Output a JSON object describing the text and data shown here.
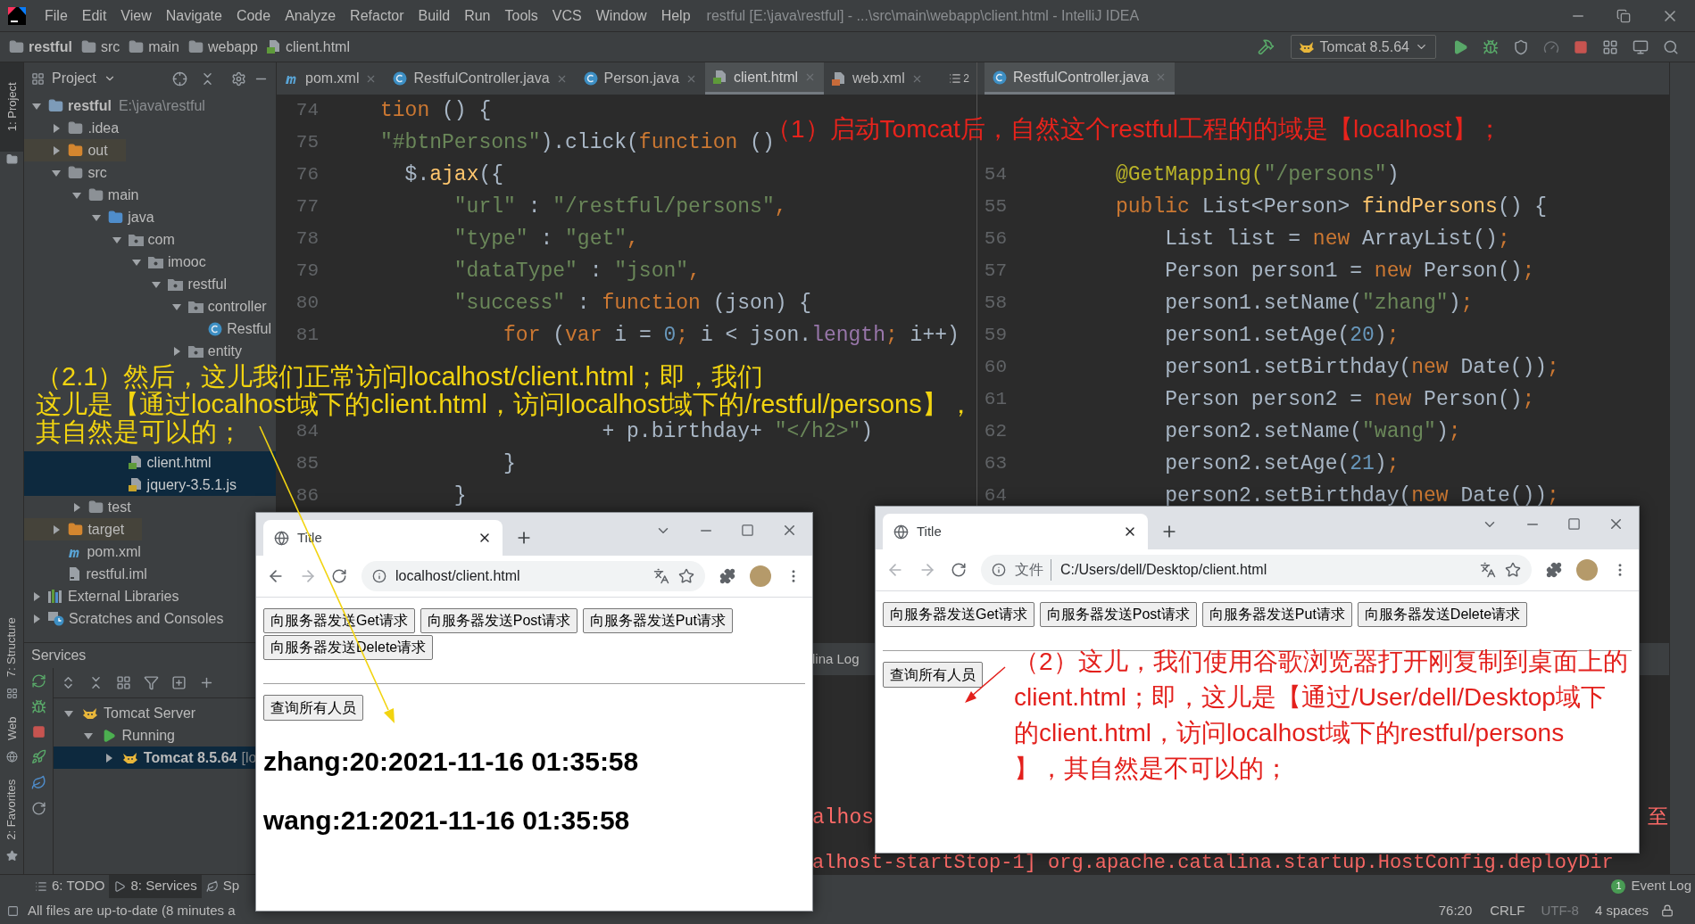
{
  "window": {
    "title": "restful [E:\\java\\restful] - ...\\src\\main\\webapp\\client.html - IntelliJ IDEA"
  },
  "menu": [
    "File",
    "Edit",
    "View",
    "Navigate",
    "Code",
    "Analyze",
    "Refactor",
    "Build",
    "Run",
    "Tools",
    "VCS",
    "Window",
    "Help"
  ],
  "breadcrumbs": [
    "restful",
    "src",
    "main",
    "webapp",
    "client.html"
  ],
  "run_config": "Tomcat 8.5.64",
  "left_stripe": [
    "1: Project",
    "7: Structure",
    "Web",
    "2: Favorites"
  ],
  "project_panel": {
    "title": "Project",
    "tree": [
      {
        "label": "restful",
        "hint": "E:\\java\\restful",
        "kind": "module",
        "expanded": true,
        "selected": false,
        "children": [
          {
            "label": ".idea",
            "kind": "folder",
            "expanded": false,
            "selected": false
          },
          {
            "label": "out",
            "kind": "excluded",
            "expanded": false,
            "selected": false
          },
          {
            "label": "src",
            "kind": "folder",
            "expanded": true,
            "selected": false,
            "children": [
              {
                "label": "main",
                "kind": "folder",
                "expanded": true,
                "selected": false,
                "children": [
                  {
                    "label": "java",
                    "kind": "source",
                    "expanded": true,
                    "selected": false,
                    "children": [
                      {
                        "label": "com",
                        "kind": "package",
                        "expanded": true,
                        "selected": false,
                        "children": [
                          {
                            "label": "imooc",
                            "kind": "package",
                            "expanded": true,
                            "selected": false,
                            "children": [
                              {
                                "label": "restful",
                                "kind": "package",
                                "expanded": true,
                                "selected": false,
                                "children": [
                                  {
                                    "label": "controller",
                                    "kind": "package",
                                    "expanded": true,
                                    "selected": false,
                                    "children": [
                                      {
                                        "label": "Restful",
                                        "kind": "class",
                                        "selected": false
                                      }
                                    ]
                                  },
                                  {
                                    "label": "entity",
                                    "kind": "package",
                                    "expanded": false,
                                    "selected": false
                                  }
                                ]
                              }
                            ]
                          }
                        ]
                      }
                    ]
                  },
                  {
                    "kind": "covered",
                    "children": [
                      {
                        "kind": "covered"
                      }
                    ]
                  },
                  {
                    "kind": "covered",
                    "children": [
                      {
                        "kind": "covered"
                      },
                      {
                        "label": "client.html",
                        "kind": "html",
                        "selected": true
                      },
                      {
                        "label": "jquery-3.5.1.js",
                        "kind": "js",
                        "selected": true
                      }
                    ]
                  }
                ]
              },
              {
                "label": "test",
                "kind": "folder",
                "expanded": false,
                "selected": false
              }
            ]
          },
          {
            "label": "target",
            "kind": "excluded",
            "expanded": false,
            "selected": false
          },
          {
            "label": "pom.xml",
            "kind": "maven",
            "selected": false
          },
          {
            "label": "restful.iml",
            "kind": "iml",
            "selected": false
          }
        ]
      },
      {
        "label": "External Libraries",
        "kind": "libraries",
        "expanded": false,
        "selected": false
      },
      {
        "label": "Scratches and Consoles",
        "kind": "scratches",
        "expanded": false,
        "selected": false
      }
    ]
  },
  "editor_tabs": [
    {
      "label": "pom.xml",
      "kind": "maven",
      "selected": false
    },
    {
      "label": "RestfulController.java",
      "kind": "class",
      "selected": false
    },
    {
      "label": "Person.java",
      "kind": "class",
      "selected": false
    },
    {
      "label": "client.html",
      "kind": "html",
      "selected": true
    },
    {
      "label": "web.xml",
      "kind": "xml",
      "selected": false
    }
  ],
  "tab_overflow": "2",
  "left_editor": {
    "lines": [
      {
        "number": "74",
        "tokens": [
          {
            "text": "tion",
            "kind": "keyword"
          },
          {
            "text": " () {",
            "kind": "plain"
          }
        ]
      },
      {
        "number": "75",
        "tokens": [
          {
            "text": "\"#btnPersons\"",
            "kind": "string"
          },
          {
            "text": ").click(",
            "kind": "plain"
          },
          {
            "text": "function",
            "kind": "keyword"
          },
          {
            "text": " ()",
            "kind": "plain"
          }
        ]
      },
      {
        "number": "76",
        "tokens": [
          {
            "text": "  $.",
            "kind": "plain"
          },
          {
            "text": "ajax",
            "kind": "func"
          },
          {
            "text": "({",
            "kind": "plain"
          }
        ]
      },
      {
        "number": "77",
        "tokens": [
          {
            "text": "      \"url\"",
            "kind": "string"
          },
          {
            "text": " : ",
            "kind": "plain"
          },
          {
            "text": "\"/restful/persons\"",
            "kind": "string"
          },
          {
            "text": ",",
            "kind": "keyword"
          }
        ]
      },
      {
        "number": "78",
        "tokens": [
          {
            "text": "      \"type\"",
            "kind": "string"
          },
          {
            "text": " : ",
            "kind": "plain"
          },
          {
            "text": "\"get\"",
            "kind": "string"
          },
          {
            "text": ",",
            "kind": "keyword"
          }
        ]
      },
      {
        "number": "79",
        "tokens": [
          {
            "text": "      \"dataType\"",
            "kind": "string"
          },
          {
            "text": " : ",
            "kind": "plain"
          },
          {
            "text": "\"json\"",
            "kind": "string"
          },
          {
            "text": ",",
            "kind": "keyword"
          }
        ]
      },
      {
        "number": "80",
        "tokens": [
          {
            "text": "      \"success\"",
            "kind": "string"
          },
          {
            "text": " : ",
            "kind": "plain"
          },
          {
            "text": "function",
            "kind": "keyword"
          },
          {
            "text": " (json) {",
            "kind": "plain"
          }
        ]
      },
      {
        "number": "81",
        "tokens": [
          {
            "text": "          for",
            "kind": "keyword"
          },
          {
            "text": " (",
            "kind": "plain"
          },
          {
            "text": "var",
            "kind": "keyword"
          },
          {
            "text": " i = ",
            "kind": "plain"
          },
          {
            "text": "0",
            "kind": "number"
          },
          {
            "text": ";",
            "kind": "keyword"
          },
          {
            "text": " i < json.",
            "kind": "plain"
          },
          {
            "text": "length",
            "kind": "field"
          },
          {
            "text": ";",
            "kind": "keyword"
          },
          {
            "text": " i++)",
            "kind": "plain"
          }
        ]
      },
      {
        "kind": "covered"
      },
      {
        "kind": "covered"
      },
      {
        "number": "84",
        "tokens": [
          {
            "text": "                  + p.birthday+ ",
            "kind": "plain"
          },
          {
            "text": "\"</h2>\"",
            "kind": "string"
          },
          {
            "text": ")",
            "kind": "plain"
          }
        ]
      },
      {
        "number": "85",
        "tokens": [
          {
            "text": "          }",
            "kind": "plain"
          }
        ]
      },
      {
        "number": "86",
        "tokens": [
          {
            "text": "      }",
            "kind": "plain"
          }
        ]
      }
    ]
  },
  "right_tabs": [
    {
      "label": "RestfulController.java",
      "kind": "class",
      "selected": true
    }
  ],
  "right_editor": {
    "lines": [
      {
        "kind": "covered"
      },
      {
        "kind": "covered"
      },
      {
        "number": "54",
        "tokens": [
          {
            "text": "@GetMapping(",
            "kind": "annotation"
          },
          {
            "text": "\"/persons\"",
            "kind": "string"
          },
          {
            "text": ")",
            "kind": "plain"
          }
        ]
      },
      {
        "number": "55",
        "tokens": [
          {
            "text": "public",
            "kind": "keyword"
          },
          {
            "text": " List<Person> ",
            "kind": "plain"
          },
          {
            "text": "findPersons",
            "kind": "func"
          },
          {
            "text": "() {",
            "kind": "plain"
          }
        ]
      },
      {
        "number": "56",
        "tokens": [
          {
            "text": "    List list = ",
            "kind": "plain"
          },
          {
            "text": "new",
            "kind": "keyword"
          },
          {
            "text": " ArrayList()",
            "kind": "plain"
          },
          {
            "text": ";",
            "kind": "keyword"
          }
        ]
      },
      {
        "number": "57",
        "tokens": [
          {
            "text": "    Person person1 = ",
            "kind": "plain"
          },
          {
            "text": "new",
            "kind": "keyword"
          },
          {
            "text": " Person()",
            "kind": "plain"
          },
          {
            "text": ";",
            "kind": "keyword"
          }
        ]
      },
      {
        "number": "58",
        "tokens": [
          {
            "text": "    person1.setName(",
            "kind": "plain"
          },
          {
            "text": "\"zhang\"",
            "kind": "string"
          },
          {
            "text": ")",
            "kind": "plain"
          },
          {
            "text": ";",
            "kind": "keyword"
          }
        ]
      },
      {
        "number": "59",
        "tokens": [
          {
            "text": "    person1.setAge(",
            "kind": "plain"
          },
          {
            "text": "20",
            "kind": "number"
          },
          {
            "text": ")",
            "kind": "plain"
          },
          {
            "text": ";",
            "kind": "keyword"
          }
        ]
      },
      {
        "number": "60",
        "tokens": [
          {
            "text": "    person1.setBirthday(",
            "kind": "plain"
          },
          {
            "text": "new",
            "kind": "keyword"
          },
          {
            "text": " Date())",
            "kind": "plain"
          },
          {
            "text": ";",
            "kind": "keyword"
          }
        ]
      },
      {
        "number": "61",
        "tokens": [
          {
            "text": "    Person person2 = ",
            "kind": "plain"
          },
          {
            "text": "new",
            "kind": "keyword"
          },
          {
            "text": " Person()",
            "kind": "plain"
          },
          {
            "text": ";",
            "kind": "keyword"
          }
        ]
      },
      {
        "number": "62",
        "tokens": [
          {
            "text": "    person2.setName(",
            "kind": "plain"
          },
          {
            "text": "\"wang\"",
            "kind": "string"
          },
          {
            "text": ")",
            "kind": "plain"
          },
          {
            "text": ";",
            "kind": "keyword"
          }
        ]
      },
      {
        "number": "63",
        "tokens": [
          {
            "text": "    person2.setAge(",
            "kind": "plain"
          },
          {
            "text": "21",
            "kind": "number"
          },
          {
            "text": ")",
            "kind": "plain"
          },
          {
            "text": ";",
            "kind": "keyword"
          }
        ]
      },
      {
        "number": "64",
        "tokens": [
          {
            "text": "    person2.setBirthday(",
            "kind": "plain"
          },
          {
            "text": "new",
            "kind": "keyword"
          },
          {
            "text": " Date())",
            "kind": "plain"
          },
          {
            "text": ";",
            "kind": "keyword"
          }
        ]
      }
    ]
  },
  "services": {
    "title": "Services",
    "tree": [
      {
        "label": "Tomcat Server",
        "kind": "server",
        "expanded": true,
        "selected": false,
        "children": [
          {
            "label": "Running",
            "kind": "running",
            "expanded": true,
            "selected": false,
            "children": [
              {
                "label": "Tomcat 8.5.64",
                "hint": "[lo",
                "kind": "server",
                "expanded": false,
                "selected": true
              }
            ]
          }
        ]
      }
    ]
  },
  "console": {
    "tab": "lina Log",
    "lines": [
      {
        "text": "alhos",
        "tail": "至"
      },
      {
        "text": "alhost-startStop-1] org.apache.catalina.startup.HostConfig.deployDir"
      }
    ]
  },
  "tool_tabs": [
    {
      "label": "6: TODO",
      "kind": "todo",
      "selected": false
    },
    {
      "label": "8: Services",
      "kind": "services",
      "selected": true
    },
    {
      "label": "Sp",
      "kind": "spring",
      "selected": false
    }
  ],
  "event_log": {
    "count": "1",
    "label": "Event Log"
  },
  "status": {
    "message": "All files are up-to-date (8 minutes a",
    "position": "76:20",
    "line_ending": "CRLF",
    "encoding": "UTF-8",
    "indent": "4 spaces"
  },
  "browsers": [
    {
      "tab_title": "Title",
      "url": "localhost/client.html",
      "back_disabled": false,
      "forward_disabled": true,
      "buttons": [
        "向服务器发送Get请求",
        "向服务器发送Post请求",
        "向服务器发送Put请求",
        "向服务器发送Delete请求"
      ],
      "query_button": "查询所有人员",
      "results": [
        "zhang:20:2021-11-16 01:35:58",
        "wang:21:2021-11-16 01:35:58"
      ]
    },
    {
      "tab_title": "Title",
      "scheme_label": "文件",
      "url": "C:/Users/dell/Desktop/client.html",
      "back_disabled": true,
      "forward_disabled": true,
      "buttons": [
        "向服务器发送Get请求",
        "向服务器发送Post请求",
        "向服务器发送Put请求",
        "向服务器发送Delete请求"
      ],
      "query_button": "查询所有人员"
    }
  ],
  "annotations": [
    {
      "color": "#e8231c",
      "lines": [
        "（1）启动Tomcat后，自然这个restful工程的的域是【localhost】；"
      ]
    },
    {
      "color": "#f2d410",
      "lines": [
        "（2.1）然后，这儿我们正常访问localhost/client.html；即，我们",
        "这儿是【通过localhost域下的client.html，访问localhost域下的/restful/persons】，",
        "其自然是可以的；"
      ]
    },
    {
      "color": "#e3201c",
      "lines": [
        "（2）这儿，我们使用谷歌浏览器打开刚复制到桌面上的",
        "client.html；即，这儿是【通过/User/dell/Desktop域下",
        "的client.html，访问localhost域下的restful/persons",
        "】，其自然是不可以的；"
      ]
    }
  ]
}
